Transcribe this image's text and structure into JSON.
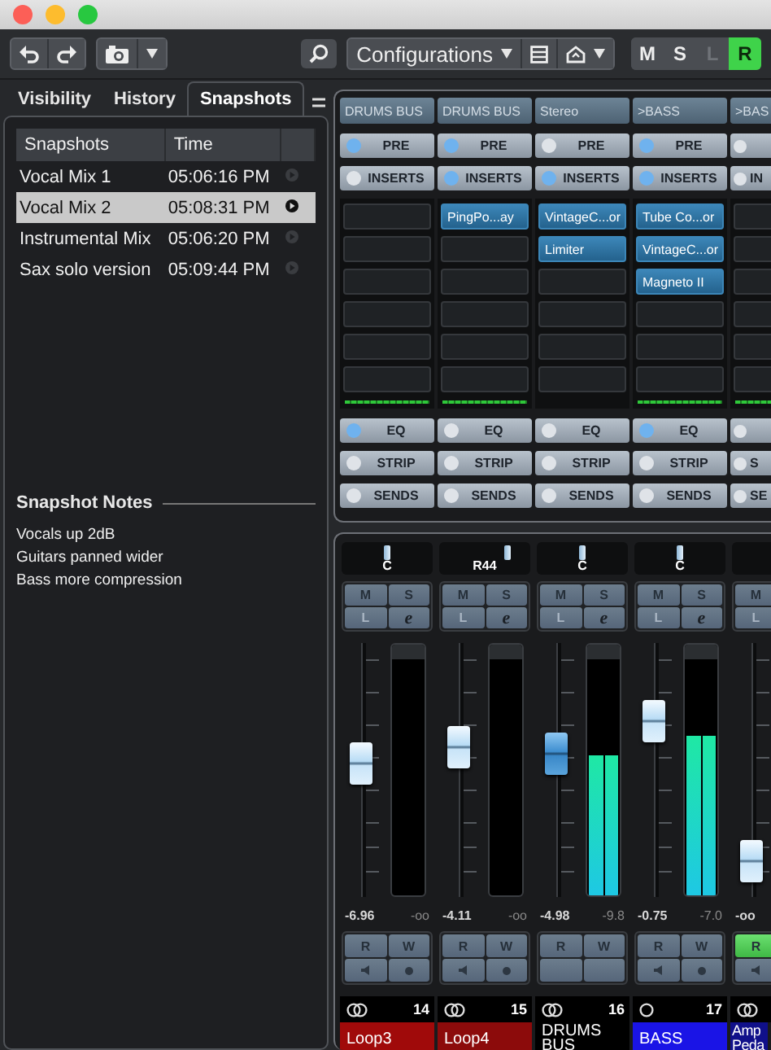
{
  "window": {
    "controls": [
      {
        "kind": "close"
      },
      {
        "kind": "minimize"
      },
      {
        "kind": "zoom"
      }
    ]
  },
  "toolbar": {
    "configurations": "Configurations",
    "modes": [
      {
        "label": "M",
        "selected": false,
        "disabled": false
      },
      {
        "label": "S",
        "selected": false,
        "disabled": false
      },
      {
        "label": "L",
        "selected": false,
        "disabled": true
      },
      {
        "label": "R",
        "selected": true,
        "disabled": false
      }
    ]
  },
  "tabs": [
    {
      "label": "Visibility",
      "selected": false
    },
    {
      "label": "History",
      "selected": false
    },
    {
      "label": "Snapshots",
      "selected": true
    }
  ],
  "snapshots": {
    "columns": [
      "Snapshots",
      "Time"
    ],
    "rows": [
      {
        "name": "Vocal Mix 1",
        "time": "05:06:16 PM",
        "selected": false
      },
      {
        "name": "Vocal Mix 2",
        "time": "05:08:31 PM",
        "selected": true
      },
      {
        "name": "Instrumental Mix",
        "time": "05:06:20 PM",
        "selected": false
      },
      {
        "name": "Sax solo version",
        "time": "05:09:44 PM",
        "selected": false
      }
    ]
  },
  "notes": {
    "title": "Snapshot Notes",
    "lines": [
      "Vocals up 2dB",
      "Guitars panned wider",
      "Bass more compression"
    ]
  },
  "channels": [
    {
      "output": "DRUMS BUS",
      "pre": {
        "label": "PRE",
        "on": true
      },
      "inserts": {
        "label": "INSERTS",
        "on": false
      },
      "insert_meter": true,
      "eq": {
        "label": "EQ",
        "on": true
      },
      "strip": {
        "label": "STRIP",
        "on": false
      },
      "sends": {
        "label": "SENDS",
        "on": false
      },
      "pan": {
        "reading": "C",
        "level": 0.5
      },
      "buttons": [
        [
          {
            "label": "M"
          },
          {
            "label": "S"
          }
        ],
        [
          {
            "label": "L",
            "disabled": true
          },
          {
            "label": "e"
          }
        ]
      ],
      "fader": {
        "level": 0.53,
        "selected": false
      },
      "meter": {
        "level": 0
      },
      "volume": "-6.96",
      "peak": "-oo",
      "automation": [
        [
          {
            "kind": "read",
            "label": "R",
            "on": false
          },
          {
            "kind": "write",
            "label": "W",
            "on": false
          }
        ],
        [
          {
            "kind": "speaker"
          },
          {
            "kind": "dot"
          }
        ]
      ],
      "stereo": true,
      "number": "14",
      "name": "Loop3",
      "color": "#a00a0a"
    },
    {
      "output": "DRUMS BUS",
      "pre": {
        "label": "PRE",
        "on": true
      },
      "inserts": {
        "label": "INSERTS",
        "on": true
      },
      "slots": [
        "PingPo...ay"
      ],
      "insert_meter": true,
      "eq": {
        "label": "EQ",
        "on": false
      },
      "strip": {
        "label": "STRIP",
        "on": false
      },
      "sends": {
        "label": "SENDS",
        "on": false
      },
      "pan": {
        "reading": "R44",
        "level": 0.75
      },
      "buttons": [
        [
          {
            "label": "M"
          },
          {
            "label": "S"
          }
        ],
        [
          {
            "label": "L",
            "disabled": true
          },
          {
            "label": "e"
          }
        ]
      ],
      "fader": {
        "level": 0.61,
        "selected": false
      },
      "meter": {
        "level": 0
      },
      "volume": "-4.11",
      "peak": "-oo",
      "automation": [
        [
          {
            "kind": "read",
            "label": "R",
            "on": false
          },
          {
            "kind": "write",
            "label": "W",
            "on": false
          }
        ],
        [
          {
            "kind": "speaker"
          },
          {
            "kind": "dot"
          }
        ]
      ],
      "stereo": true,
      "number": "15",
      "name": "Loop4",
      "color": "#8c0b0b"
    },
    {
      "output": "Stereo",
      "pre": {
        "label": "PRE",
        "on": false
      },
      "inserts": {
        "label": "INSERTS",
        "on": true
      },
      "slots": [
        "VintageC...or",
        "Limiter"
      ],
      "insert_meter": false,
      "eq": {
        "label": "EQ",
        "on": false
      },
      "strip": {
        "label": "STRIP",
        "on": false
      },
      "sends": {
        "label": "SENDS",
        "on": false
      },
      "pan": {
        "reading": "C",
        "level": 0.5
      },
      "buttons": [
        [
          {
            "label": "M"
          },
          {
            "label": "S"
          }
        ],
        [
          {
            "label": "L",
            "disabled": true
          },
          {
            "label": "e"
          }
        ]
      ],
      "fader": {
        "level": 0.58,
        "selected": true
      },
      "meter": {
        "level": 0.6
      },
      "volume": "-4.98",
      "peak": "-9.8",
      "automation": [
        [
          {
            "kind": "read",
            "label": "R",
            "on": false
          },
          {
            "kind": "write",
            "label": "W",
            "on": false
          }
        ],
        [
          {
            "kind": "blank"
          },
          {
            "kind": "blank"
          }
        ]
      ],
      "stereo": true,
      "number": "16",
      "name": "DRUMS BUS",
      "color": "#000000"
    },
    {
      "output": ">BASS",
      "pre": {
        "label": "PRE",
        "on": true
      },
      "inserts": {
        "label": "INSERTS",
        "on": true
      },
      "slots": [
        "Tube Co...or",
        "VintageC...or",
        "Magneto II"
      ],
      "insert_meter": true,
      "eq": {
        "label": "EQ",
        "on": true
      },
      "strip": {
        "label": "STRIP",
        "on": false
      },
      "sends": {
        "label": "SENDS",
        "on": false
      },
      "pan": {
        "reading": "C",
        "level": 0.5
      },
      "buttons": [
        [
          {
            "label": "M"
          },
          {
            "label": "S"
          }
        ],
        [
          {
            "label": "L",
            "disabled": true
          },
          {
            "label": "e"
          }
        ]
      ],
      "fader": {
        "level": 0.73,
        "selected": false
      },
      "meter": {
        "level": 0.68
      },
      "volume": "-0.75",
      "peak": "-7.0",
      "automation": [
        [
          {
            "kind": "read",
            "label": "R",
            "on": false
          },
          {
            "kind": "write",
            "label": "W",
            "on": false
          }
        ],
        [
          {
            "kind": "speaker"
          },
          {
            "kind": "dot"
          }
        ]
      ],
      "stereo": false,
      "number": "17",
      "name": "BASS",
      "color": "#1a14e6"
    },
    {
      "output": ">BAS",
      "pre": {
        "on": false
      },
      "inserts": {
        "label": "IN",
        "on": false
      },
      "insert_meter": true,
      "eq": {
        "on": false
      },
      "strip": {
        "label": "S",
        "on": false
      },
      "sends": {
        "label": "SE",
        "on": false
      },
      "buttons": [
        [
          {
            "label": "M"
          }
        ],
        [
          {
            "label": "L",
            "disabled": true
          }
        ]
      ],
      "fader": {
        "level": 0.07,
        "selected": false
      },
      "volume": "-oo",
      "automation": [
        [
          {
            "kind": "read",
            "label": "R",
            "on": true
          }
        ],
        [
          {
            "kind": "speaker"
          }
        ]
      ],
      "stereo": true,
      "name": "Amp Peda",
      "color": "#10108a"
    }
  ]
}
